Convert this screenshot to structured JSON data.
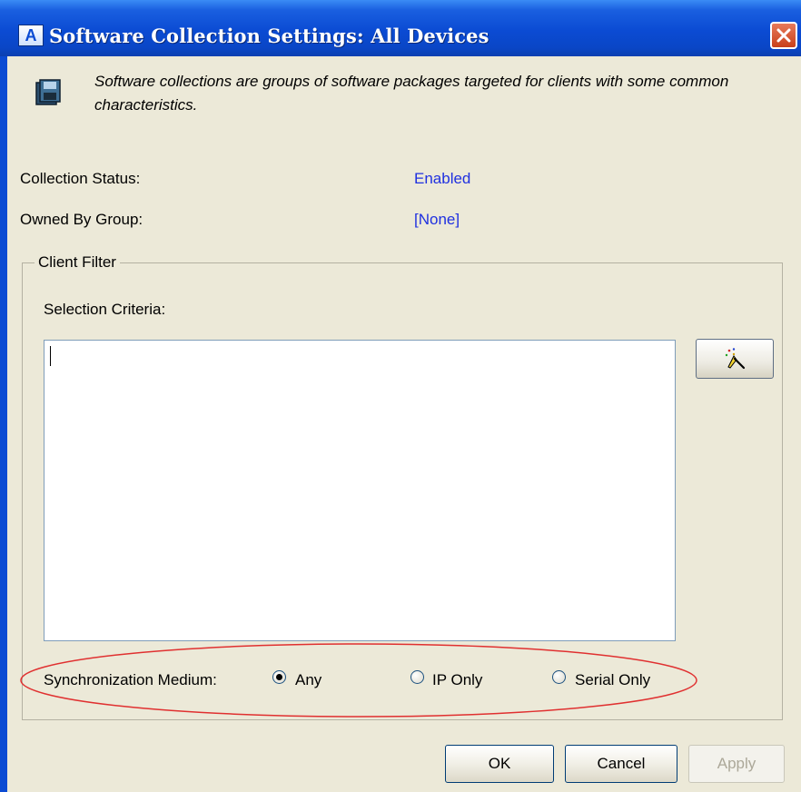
{
  "window": {
    "title": "Software Collection Settings: All Devices",
    "logo_letter": "A",
    "close_icon": "close-icon"
  },
  "intro": {
    "icon": "floppy-disk-icon",
    "text": "Software collections are groups of software packages targeted for clients with some common characteristics."
  },
  "fields": {
    "status_label": "Collection Status:",
    "status_value": "Enabled",
    "group_label": "Owned By Group:",
    "group_value": "[None]"
  },
  "client_filter": {
    "legend": "Client Filter",
    "criteria_label": "Selection Criteria:",
    "criteria_value": "",
    "wizard_icon": "magic-wand-icon"
  },
  "sync": {
    "label": "Synchronization Medium:",
    "options": [
      "Any",
      "IP Only",
      "Serial Only"
    ],
    "selected": "Any"
  },
  "buttons": {
    "ok": "OK",
    "cancel": "Cancel",
    "apply": "Apply"
  },
  "colors": {
    "title_bar": "#0B4BD3",
    "link_value": "#1F30E0",
    "highlight": "#E03030"
  }
}
